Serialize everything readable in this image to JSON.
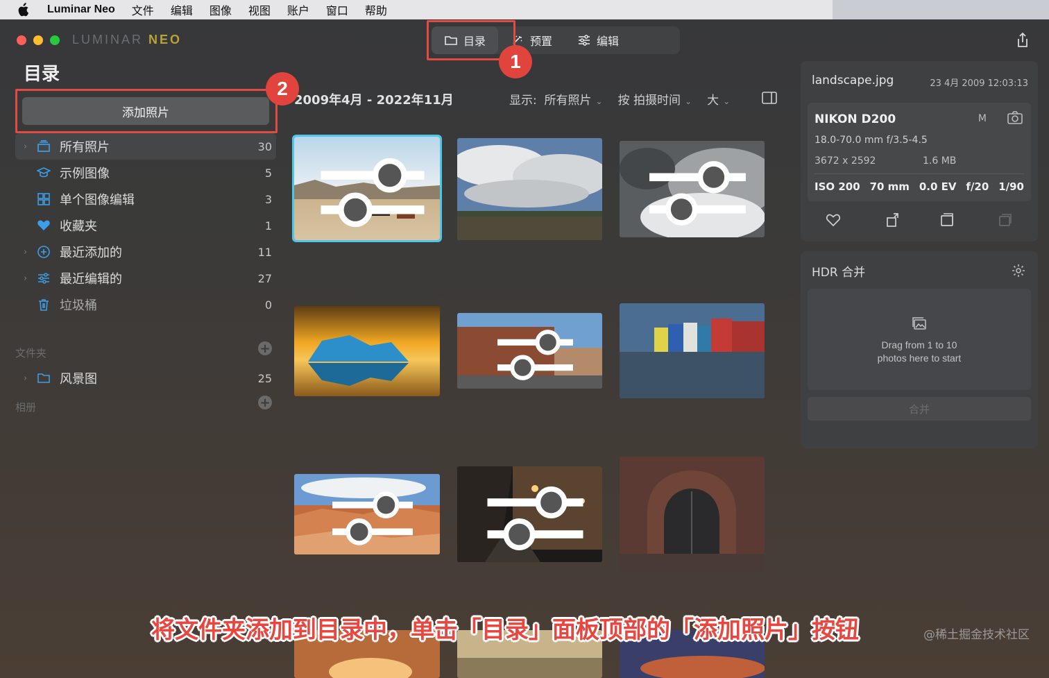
{
  "menubar": {
    "app_name": "Luminar Neo",
    "items": [
      "文件",
      "编辑",
      "图像",
      "视图",
      "账户",
      "窗口",
      "帮助"
    ]
  },
  "window": {
    "logo_left": "LUMINAR",
    "logo_right": "NEO"
  },
  "topnav": {
    "tabs": [
      {
        "label": "目录",
        "icon": "folder-icon",
        "active": true
      },
      {
        "label": "预置",
        "icon": "sparkle-icon",
        "active": false
      },
      {
        "label": "编辑",
        "icon": "sliders-icon",
        "active": false
      }
    ]
  },
  "annotations": {
    "step1": "1",
    "step2": "2",
    "caption": "将文件夹添加到目录中，单击「目录」面板顶部的「添加照片」按钮",
    "watermark": "@稀土掘金技术社区",
    "highlight_color": "#e04b44"
  },
  "sidebar": {
    "title": "目录",
    "add_button": "添加照片",
    "items": [
      {
        "label": "所有照片",
        "count": "30",
        "icon": "stack-icon"
      },
      {
        "label": "示例图像",
        "count": "5",
        "icon": "graduation-cap-icon"
      },
      {
        "label": "单个图像编辑",
        "count": "3",
        "icon": "grid-icon"
      },
      {
        "label": "收藏夹",
        "count": "1",
        "icon": "heart-icon"
      },
      {
        "label": "最近添加的",
        "count": "11",
        "icon": "plus-circle-icon"
      },
      {
        "label": "最近编辑的",
        "count": "27",
        "icon": "sliders-icon"
      },
      {
        "label": "垃圾桶",
        "count": "0",
        "icon": "trash-icon"
      }
    ],
    "folders_section": "文件夹",
    "folders": [
      {
        "label": "风景图",
        "count": "25",
        "icon": "folder-icon"
      }
    ],
    "albums_section": "相册"
  },
  "content": {
    "date_range": "2009年4月 - 2022年11月",
    "show_label": "显示:",
    "show_value": "所有照片",
    "sort_label": "按 拍摄时间",
    "size_label": "大"
  },
  "info": {
    "filename": "landscape.jpg",
    "datetime": "23 4月 2009 12:03:13",
    "camera": "NIKON D200",
    "mode": "M",
    "lens": "18.0-70.0 mm f/3.5-4.5",
    "resolution": "3672 x 2592",
    "filesize": "1.6 MB",
    "iso": "ISO 200",
    "focal": "70 mm",
    "ev": "0.0 EV",
    "aperture": "f/20",
    "shutter": "1/90"
  },
  "hdr": {
    "title": "HDR 合并",
    "drop_line1": "Drag from 1 to 10",
    "drop_line2": "photos here to start",
    "merge_button": "合并"
  },
  "colors": {
    "accent_selection": "#4ec6e6",
    "logo_neo": "#b8a338",
    "step_badge": "#e0443c"
  }
}
